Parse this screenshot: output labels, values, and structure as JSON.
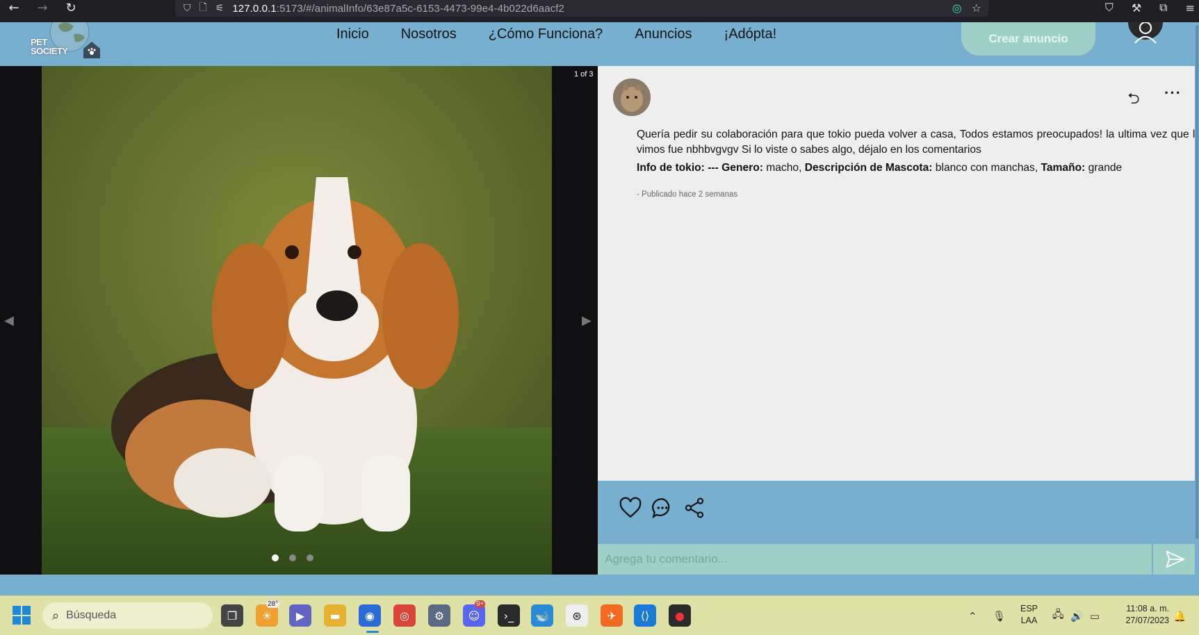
{
  "browser": {
    "url_host": "127.0.0.1",
    "url_rest": ":5173/#/animalInfo/63e87a5c-6153-4473-99e4-4b022d6aacf2",
    "icons": [
      "back-icon",
      "forward-icon",
      "reload-icon",
      "shield-icon",
      "page-icon",
      "permissions-icon",
      "extension-icon",
      "bookmark-star-icon",
      "pocket-icon",
      "tools-icon",
      "extensions-icon",
      "menu-icon"
    ]
  },
  "header": {
    "logo_line1": "PET",
    "logo_line2": "SOCIETY",
    "nav": [
      "Inicio",
      "Nosotros",
      "¿Cómo Funciona?",
      "Anuncios",
      "¡Adópta!"
    ],
    "create_button": "Crear anuncio"
  },
  "carousel": {
    "counter": "1 of 3",
    "slide_count": 3,
    "active_index": 0
  },
  "post": {
    "body": "Quería pedir su colaboración para que tokio pueda volver a casa, Todos estamos preocupados! la ultima vez que lo vimos fue nbhbvgvgv Si lo viste o sabes algo, déjalo en los comentarios",
    "info_label": "Info de tokio:",
    "info_sep": " --- ",
    "genero_label": "Genero:",
    "genero_value": " macho, ",
    "desc_label": "Descripción de Mascota:",
    "desc_value": " blanco con manchas, ",
    "tamano_label": "Tamaño:",
    "tamano_value": " grande",
    "time": "- Publicado hace 2 semanas"
  },
  "comment": {
    "placeholder": "Agrega tu comentario..."
  },
  "taskbar": {
    "search_label": "Búsqueda",
    "weather_temp": "28°",
    "lang_line1": "ESP",
    "lang_line2": "LAA",
    "time": "11:08 a. m.",
    "date": "27/07/2023",
    "discord_badge": "9+"
  },
  "colors": {
    "header_bg": "#76afd0",
    "accent_green": "#9ed0c6",
    "panel_bg": "#eeeeee",
    "taskbar_bg": "#dfe2a6"
  }
}
